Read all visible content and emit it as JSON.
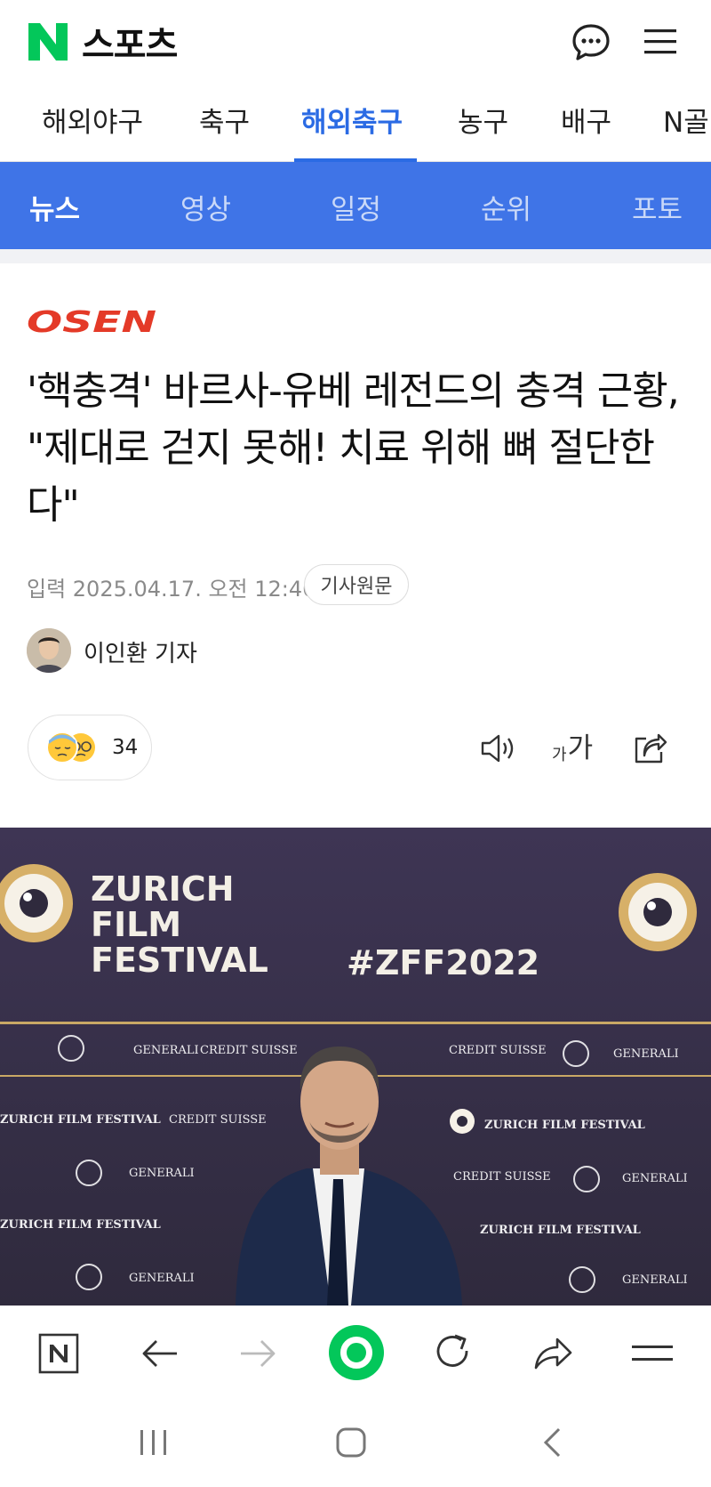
{
  "header": {
    "brand": "스포츠"
  },
  "categories": [
    {
      "label": "해외야구",
      "active": false
    },
    {
      "label": "축구",
      "active": false
    },
    {
      "label": "해외축구",
      "active": true
    },
    {
      "label": "농구",
      "active": false
    },
    {
      "label": "배구",
      "active": false
    },
    {
      "label": "N골",
      "active": false
    }
  ],
  "subtabs": [
    {
      "label": "뉴스",
      "active": true
    },
    {
      "label": "영상",
      "active": false
    },
    {
      "label": "일정",
      "active": false
    },
    {
      "label": "순위",
      "active": false
    },
    {
      "label": "포토",
      "active": false
    }
  ],
  "article": {
    "source": "OSEN",
    "headline": "'핵충격' 바르사-유베 레전드의 충격 근황, \"제대로 걷지 못해! 치료 위해 뼈 절단한다\"",
    "dateline": "입력 2025.04.17. 오전 12:46",
    "original_button": "기사원문",
    "author": "이인환 기자",
    "reaction_count": "34",
    "font_size_icon_small": "가",
    "font_size_icon_large": "가"
  },
  "photo": {
    "brand_lines": [
      "ZURICH",
      "FILM",
      "FESTIVAL"
    ],
    "hashtag": "#ZFF2022",
    "sponsor_a": "GENERALI",
    "sponsor_b": "CREDIT SUISSE",
    "sponsor_c": "ZURICH FILM FESTIVAL"
  },
  "colors": {
    "accent": "#2b6be4",
    "subbar": "#3f74e7",
    "naver_green": "#03c75a",
    "osen_red": "#e43a28"
  }
}
